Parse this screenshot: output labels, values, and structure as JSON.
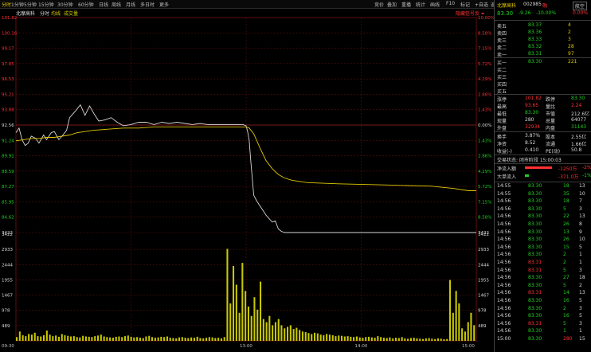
{
  "toolbar": {
    "left": [
      "分时",
      "1分钟",
      "5分钟",
      "15分钟",
      "30分钟",
      "60分钟",
      "日线",
      "周线",
      "月线",
      "多日时",
      "更多"
    ],
    "right": [
      "竞价",
      "叠加",
      "重播",
      "统计",
      "画线",
      "F10",
      "标记",
      "+自选",
      "返回"
    ]
  },
  "chart_header": {
    "stock_label": "北摩高科",
    "tabs": [
      "分时",
      "均线",
      "成交量"
    ],
    "right_label": "隐藏信号反 ⏷"
  },
  "chart_data": [
    {
      "type": "line",
      "price_axis": {
        "left_labels": [
          "101.82",
          "100.16",
          "99.17",
          "97.85",
          "96.53",
          "95.21",
          "93.88",
          "92.56",
          "91.24",
          "89.91",
          "88.59",
          "87.27",
          "85.95",
          "84.62",
          "3422"
        ],
        "right_labels": [
          "10.00%",
          "8.58%",
          "7.15%",
          "5.72%",
          "4.29%",
          "2.86%",
          "1.43%",
          "0.00%",
          "1.43%",
          "2.86%",
          "4.29%",
          "5.72%",
          "7.15%",
          "8.58%",
          "3422"
        ],
        "ylim": [
          83.3,
          101.82
        ],
        "prev_close": 92.56
      },
      "series": [
        {
          "name": "分时",
          "color": "#d8d8d8",
          "x": [
            0,
            4,
            8,
            12,
            16,
            20,
            26,
            30,
            36,
            40,
            46,
            50,
            56,
            60,
            66,
            70,
            78,
            84,
            90,
            96,
            102,
            108,
            116,
            124,
            132,
            140,
            150,
            160,
            170,
            180,
            190,
            200,
            210,
            220,
            230,
            240,
            250,
            260,
            270,
            280,
            290,
            296,
            300,
            302,
            304,
            306,
            308,
            310,
            314,
            318,
            322,
            326,
            330,
            334,
            338,
            342,
            346,
            350,
            354,
            360,
            380,
            420,
            480,
            540,
            580,
            600
          ],
          "y": [
            91.9,
            92.3,
            91.3,
            90.8,
            91.0,
            91.6,
            91.4,
            91.0,
            91.7,
            91.3,
            91.9,
            92.0,
            91.3,
            91.6,
            92.1,
            93.2,
            93.8,
            94.3,
            93.4,
            94.2,
            93.5,
            92.9,
            93.0,
            93.2,
            92.8,
            92.5,
            92.6,
            92.8,
            92.8,
            92.6,
            92.8,
            92.7,
            92.8,
            92.7,
            92.6,
            92.7,
            92.6,
            92.6,
            92.6,
            92.6,
            92.6,
            92.6,
            92.5,
            92.0,
            91.2,
            89.5,
            88.0,
            86.5,
            86.0,
            85.6,
            85.2,
            84.8,
            84.5,
            84.2,
            84.3,
            83.6,
            83.4,
            83.3,
            83.3,
            83.3,
            83.3,
            83.3,
            83.3,
            83.3,
            83.3,
            83.3
          ]
        },
        {
          "name": "均线",
          "color": "#e2c800",
          "x": [
            0,
            10,
            20,
            30,
            40,
            50,
            60,
            70,
            80,
            90,
            100,
            120,
            140,
            160,
            180,
            200,
            220,
            240,
            260,
            280,
            300,
            304,
            310,
            318,
            326,
            334,
            342,
            350,
            360,
            380,
            420,
            480,
            540,
            570,
            590,
            600
          ],
          "y": [
            91.2,
            91.3,
            91.4,
            91.4,
            91.5,
            91.5,
            91.6,
            91.7,
            91.9,
            92.0,
            92.1,
            92.2,
            92.3,
            92.3,
            92.4,
            92.4,
            92.4,
            92.4,
            92.4,
            92.4,
            92.4,
            92.3,
            91.8,
            90.6,
            89.5,
            88.8,
            88.3,
            88.0,
            87.8,
            87.6,
            87.5,
            87.4,
            87.3,
            87.1,
            86.9,
            86.9
          ]
        }
      ]
    },
    {
      "type": "bar",
      "title": "成交量",
      "volume_axis": {
        "left_labels": [
          "3422",
          "2933",
          "2444",
          "1955",
          "1467",
          "978",
          "489"
        ],
        "right_labels": [
          "3422",
          "2933",
          "2444",
          "1955",
          "1467",
          "978",
          "489"
        ],
        "ylim": [
          0,
          3422
        ]
      },
      "time_labels": [
        "09:30",
        "13:00",
        "14:00",
        "15:00"
      ],
      "values": [
        120,
        300,
        180,
        150,
        220,
        200,
        260,
        150,
        140,
        180,
        330,
        200,
        150,
        170,
        130,
        220,
        180,
        160,
        140,
        150,
        120,
        110,
        160,
        140,
        130,
        120,
        150,
        170,
        200,
        140,
        120,
        110,
        100,
        130,
        140,
        120,
        150,
        170,
        130,
        110,
        120,
        100,
        90,
        140,
        160,
        120,
        100,
        110,
        130,
        120,
        140,
        100,
        90,
        80,
        110,
        120,
        100,
        90,
        110,
        100,
        130,
        90,
        80,
        100,
        120,
        110,
        90,
        100,
        80,
        120,
        2950,
        1200,
        2400,
        1800,
        900,
        2500,
        1600,
        1100,
        800,
        1400,
        1000,
        1900,
        700,
        600,
        800,
        500,
        600,
        700,
        500,
        400,
        450,
        500,
        380,
        420,
        350,
        300,
        280,
        250,
        220,
        260,
        240,
        200,
        180,
        220,
        200,
        180,
        150,
        170,
        160,
        140,
        150,
        130,
        120,
        140,
        110,
        100,
        120,
        130,
        110,
        100,
        150,
        120,
        100,
        90,
        110,
        80,
        100,
        90,
        120,
        80,
        70,
        90,
        100,
        80,
        70,
        60,
        80,
        90,
        70,
        60,
        80,
        70,
        50,
        60,
        1950,
        900,
        1600,
        1200,
        400,
        300,
        600,
        900,
        500
      ]
    }
  ],
  "panel": {
    "top_button": "航空",
    "name": "北摩高科",
    "code": "002985",
    "flag": "融",
    "price": "83.30",
    "change": "-9.26",
    "pct": "-10.00%",
    "badge_pct": "0.00%",
    "asks": [
      {
        "label": "卖五",
        "price": "83.37",
        "vol": "4"
      },
      {
        "label": "卖四",
        "price": "83.36",
        "vol": "2"
      },
      {
        "label": "卖三",
        "price": "83.33",
        "vol": "3"
      },
      {
        "label": "卖二",
        "price": "83.32",
        "vol": "28"
      },
      {
        "label": "卖一",
        "price": "83.31",
        "vol": "97"
      }
    ],
    "bids": [
      {
        "label": "买一",
        "price": "83.30",
        "vol": "221"
      },
      {
        "label": "买二",
        "price": "",
        "vol": ""
      },
      {
        "label": "买三",
        "price": "",
        "vol": ""
      },
      {
        "label": "买四",
        "price": "",
        "vol": ""
      },
      {
        "label": "买五",
        "price": "",
        "vol": ""
      }
    ],
    "stats": [
      {
        "k1": "涨停",
        "v1": "101.82",
        "k2": "跌停",
        "v2": "83.30",
        "c1": "red",
        "c2": "grn"
      },
      {
        "k1": "最高",
        "v1": "93.65",
        "k2": "量比",
        "v2": "2.24",
        "c1": "red",
        "c2": "red"
      },
      {
        "k1": "最低",
        "v1": "83.30",
        "k2": "市值",
        "v2": "212.6亿",
        "c1": "grn",
        "c2": "wht"
      },
      {
        "k1": "现量",
        "v1": "280",
        "k2": "总量",
        "v2": "64077",
        "c1": "wht",
        "c2": "wht"
      },
      {
        "k1": "外盘",
        "v1": "32934",
        "k2": "内盘",
        "v2": "31143",
        "c1": "red",
        "c2": "grn"
      }
    ],
    "stats2": [
      {
        "k1": "换手",
        "v1": "3.87%",
        "k2": "股本",
        "v2": "2.55亿"
      },
      {
        "k1": "净资",
        "v1": "8.52",
        "k2": "流通",
        "v2": "1.66亿"
      },
      {
        "k1": "收益(-)",
        "v1": "0.410",
        "k2": "PE(动)",
        "v2": "50.8"
      }
    ],
    "trade_status": "交易状态: 闭市阶段 15:00:03",
    "flows": [
      {
        "label": "净流入额",
        "value": "-1250万",
        "pct": "-2%",
        "color": "#ff3030",
        "fill": 0.85
      },
      {
        "label": "大单流入",
        "value": "-371.0万",
        "pct": "-1%",
        "color": "#20d020",
        "fill": 0.12
      }
    ],
    "ticks": [
      {
        "t": "14:55",
        "p": "83.30",
        "v": "18",
        "n": "13"
      },
      {
        "t": "14:55",
        "p": "83.30",
        "v": "35",
        "n": "10"
      },
      {
        "t": "14:56",
        "p": "83.30",
        "v": "18",
        "n": "7"
      },
      {
        "t": "14:56",
        "p": "83.30",
        "v": "5",
        "n": "3"
      },
      {
        "t": "14:56",
        "p": "83.30",
        "v": "22",
        "n": "13"
      },
      {
        "t": "14:56",
        "p": "83.30",
        "v": "26",
        "n": "8"
      },
      {
        "t": "14:56",
        "p": "83.30",
        "v": "13",
        "n": "9"
      },
      {
        "t": "14:56",
        "p": "83.30",
        "v": "26",
        "n": "10"
      },
      {
        "t": "14:56",
        "p": "83.30",
        "v": "15",
        "n": "5"
      },
      {
        "t": "14:56",
        "p": "83.30",
        "v": "2",
        "n": "1"
      },
      {
        "t": "14:56",
        "p": "83.31",
        "v": "2",
        "n": "1"
      },
      {
        "t": "14:56",
        "p": "83.31",
        "v": "5",
        "n": "3"
      },
      {
        "t": "14:56",
        "p": "83.30",
        "v": "27",
        "n": "18"
      },
      {
        "t": "14:56",
        "p": "83.30",
        "v": "5",
        "n": "2"
      },
      {
        "t": "14:56",
        "p": "83.31",
        "v": "14",
        "n": "13"
      },
      {
        "t": "14:56",
        "p": "83.30",
        "v": "16",
        "n": "5"
      },
      {
        "t": "14:56",
        "p": "83.30",
        "v": "2",
        "n": "3"
      },
      {
        "t": "14:56",
        "p": "83.30",
        "v": "16",
        "n": "5"
      },
      {
        "t": "14:56",
        "p": "83.31",
        "v": "5",
        "n": "3"
      },
      {
        "t": "14:56",
        "p": "83.30",
        "v": "1",
        "n": "1"
      },
      {
        "t": "15:00",
        "p": "83.30",
        "v": "280",
        "n": "15"
      }
    ]
  },
  "colors": {
    "up": "#ff3030",
    "down": "#20d020",
    "price_line": "#d8d8d8",
    "avg_line": "#e2c800",
    "volume": "#c8c800",
    "grid": "#6a1010"
  }
}
